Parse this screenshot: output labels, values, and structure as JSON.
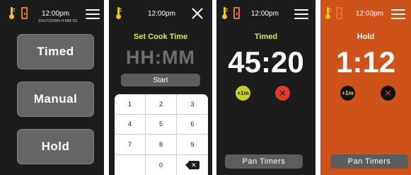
{
  "colors": {
    "screen_bg": "#1c1c1c",
    "hold_bg": "#cd531a",
    "title_accent": "#dde64f",
    "button_gray": "#666666",
    "thermometer": "#f2c21c",
    "door": "#e8742c",
    "cancel_red": "#e13b2a",
    "plus_green": "#c6cf2b"
  },
  "screens": {
    "menu": {
      "time": "12:00pm",
      "shutdown": "SHUTDOWN H:MM:SS",
      "icons": [
        "thermometer-icon",
        "door-icon",
        "hamburger-menu-icon"
      ],
      "buttons": [
        "Timed",
        "Manual",
        "Hold"
      ]
    },
    "set_time": {
      "time": "12:00pm",
      "icons": [
        "thermometer-icon",
        "close-icon"
      ],
      "title": "Set Cook Time",
      "display": "HH:MM",
      "start_label": "Start",
      "keys": [
        "1",
        "2",
        "3",
        "4",
        "5",
        "6",
        "7",
        "8",
        "9",
        "",
        "0",
        "backspace-icon"
      ]
    },
    "timed": {
      "time": "12:00pm",
      "icons": [
        "thermometer-icon",
        "door-icon",
        "hamburger-menu-icon"
      ],
      "title": "Timed",
      "countdown": "45:20",
      "plus_label": "+1m",
      "cancel_symbol": "✕",
      "pan_label": "Pan Timers"
    },
    "hold": {
      "time": "12:00pm",
      "icons": [
        "thermometer-icon",
        "door-icon",
        "hamburger-menu-icon"
      ],
      "title": "Hold",
      "countdown": "1:12",
      "plus_label": "+1m",
      "cancel_symbol": "✕",
      "pan_label": "Pan Timers"
    }
  }
}
